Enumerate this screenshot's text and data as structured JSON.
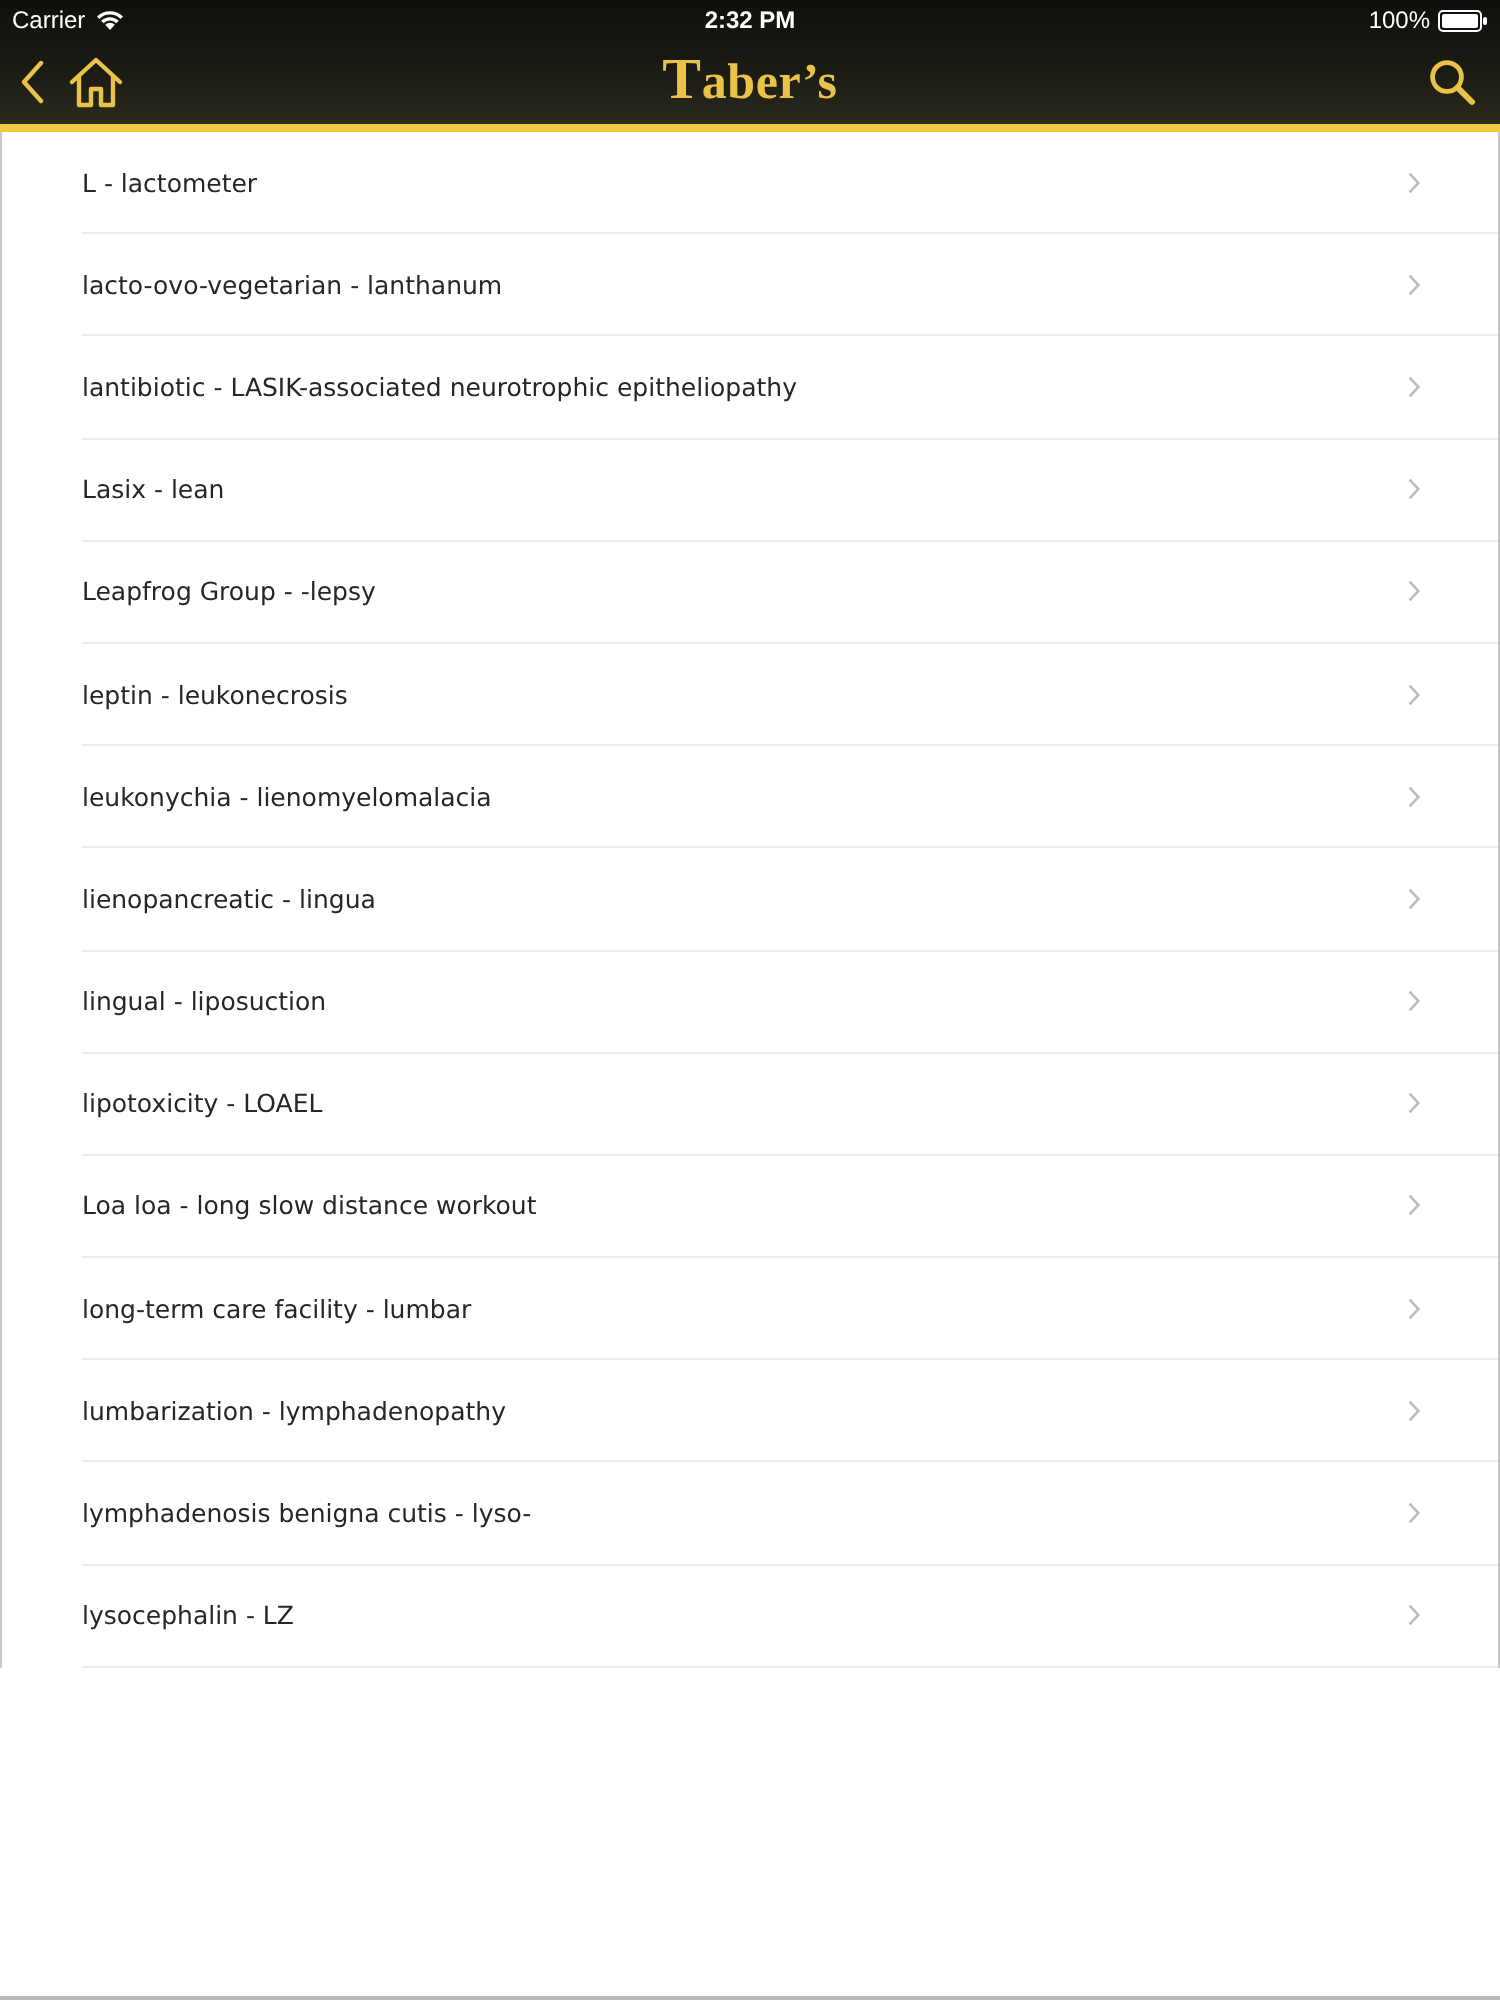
{
  "status_bar": {
    "carrier": "Carrier",
    "time": "2:32 PM",
    "battery": "100%"
  },
  "nav_bar": {
    "title": "Taber’s"
  },
  "entries": [
    {
      "label": "L - lactometer"
    },
    {
      "label": "lacto-ovo-vegetarian - lanthanum"
    },
    {
      "label": "lantibiotic - LASIK-associated neurotrophic epitheliopathy"
    },
    {
      "label": "Lasix - lean"
    },
    {
      "label": "Leapfrog Group - -lepsy"
    },
    {
      "label": "leptin - leukonecrosis"
    },
    {
      "label": "leukonychia - lienomyelomalacia"
    },
    {
      "label": "lienopancreatic - lingua"
    },
    {
      "label": "lingual - liposuction"
    },
    {
      "label": "lipotoxicity - LOAEL"
    },
    {
      "label": "Loa loa - long slow distance workout"
    },
    {
      "label": "long-term care facility - lumbar"
    },
    {
      "label": "lumbarization - lymphadenopathy"
    },
    {
      "label": "lymphadenosis benigna cutis - lyso-"
    },
    {
      "label": "lysocephalin - LZ"
    }
  ]
}
